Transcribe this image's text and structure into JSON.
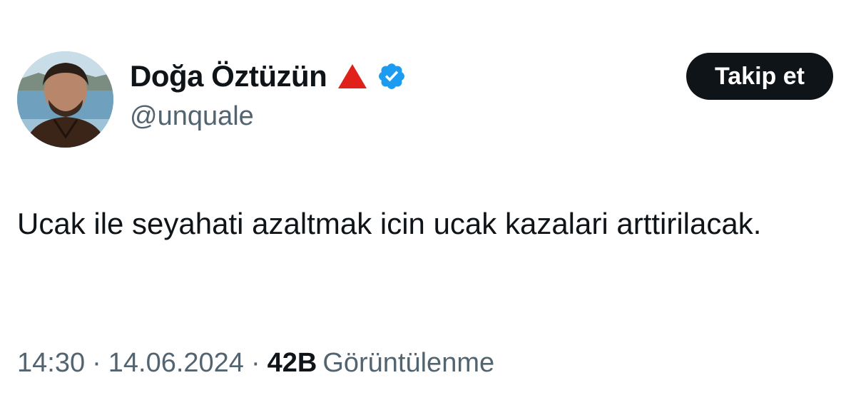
{
  "author": {
    "display_name": "Doğa Öztüzün",
    "handle": "@unquale",
    "badge_icon": "red-triangle-icon",
    "verified_icon": "verified-badge-icon",
    "verified_color": "#1d9bf0"
  },
  "follow_button": {
    "label": "Takip et"
  },
  "tweet": {
    "text": "Ucak ile seyahati azaltmak icin ucak kazalari arttirilacak."
  },
  "meta": {
    "time": "14:30",
    "separator": "·",
    "date": "14.06.2024",
    "views_count": "42B",
    "views_label": "Görüntülenme"
  },
  "colors": {
    "text_primary": "#0f1419",
    "text_secondary": "#536471",
    "button_bg": "#0f1419",
    "badge_red": "#e0201b"
  }
}
